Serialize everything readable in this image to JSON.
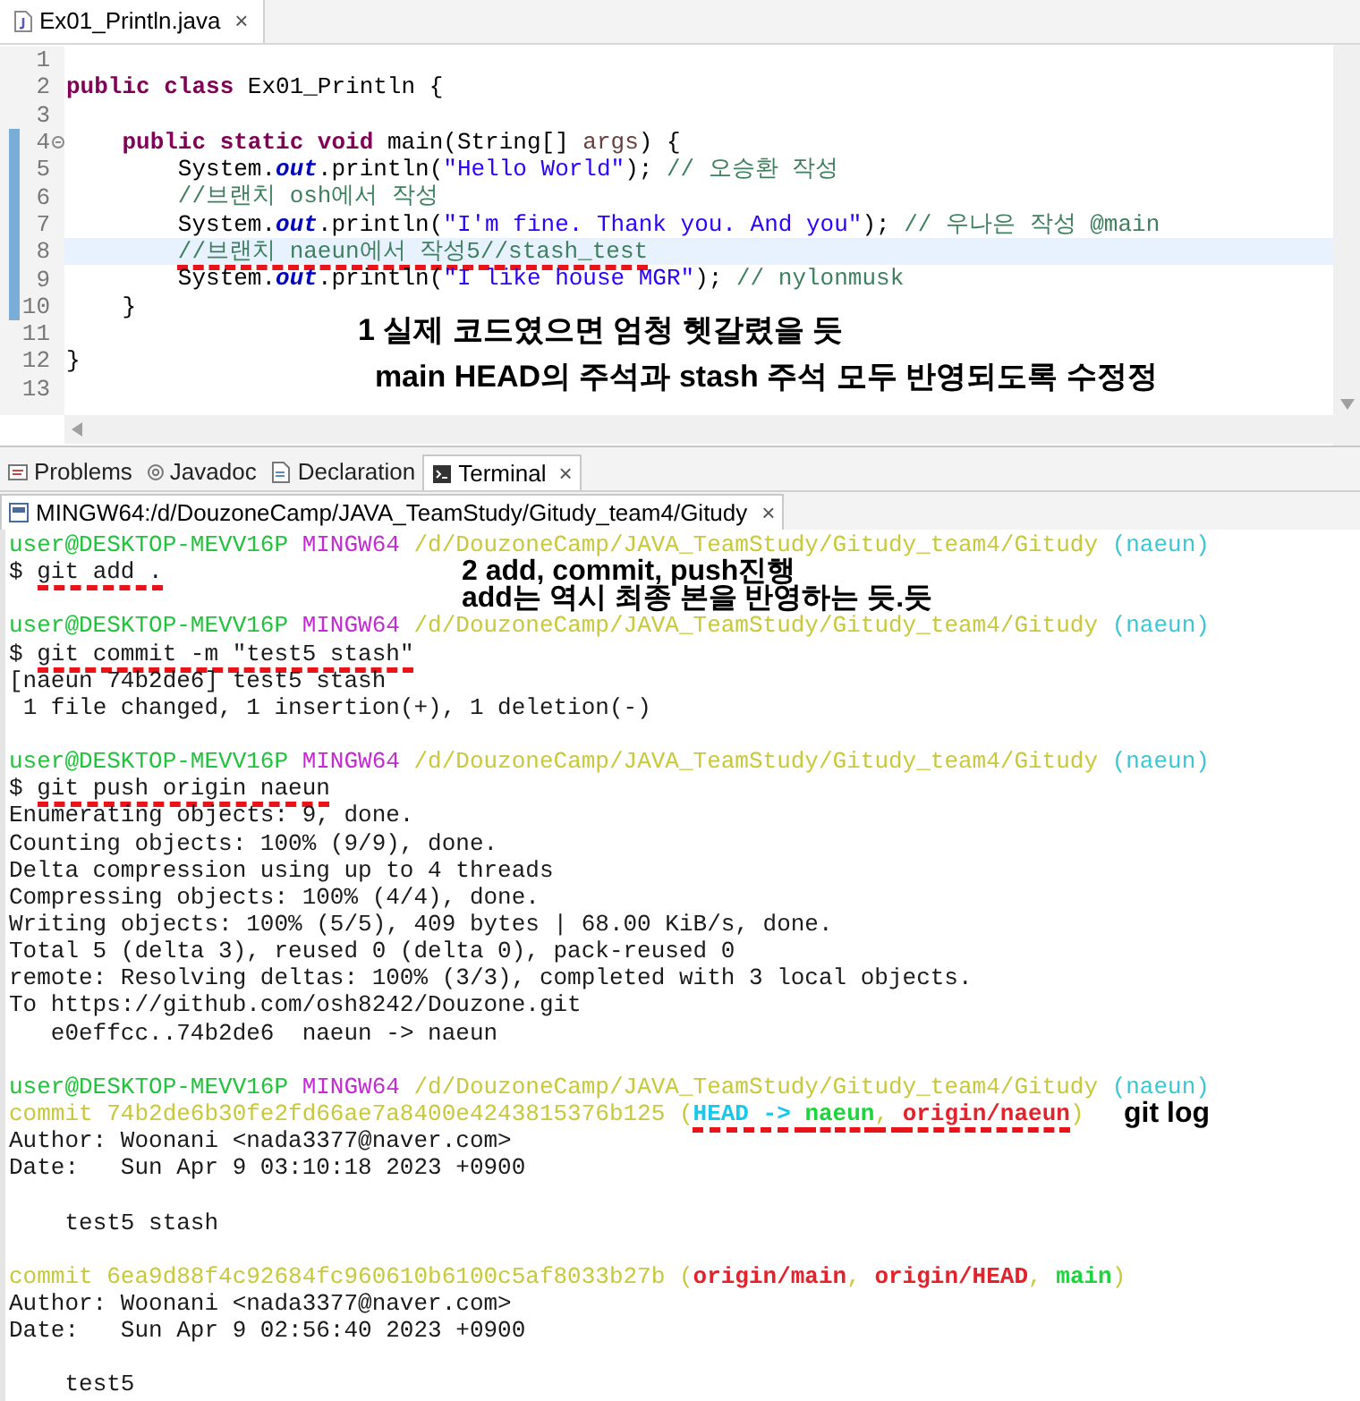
{
  "editor": {
    "tab": {
      "title": "Ex01_Println.java",
      "close": "×"
    },
    "lines": [
      {
        "number": "1",
        "changed": false,
        "current": false,
        "fold": false
      },
      {
        "number": "2",
        "changed": false,
        "current": false,
        "fold": false,
        "segments": [
          {
            "kind": "keyword",
            "text": "public class "
          },
          {
            "kind": "plain",
            "text": "Ex01_Println {"
          }
        ]
      },
      {
        "number": "3",
        "changed": false,
        "current": false,
        "fold": false
      },
      {
        "number": "4",
        "changed": true,
        "current": false,
        "fold": true,
        "segments": [
          {
            "kind": "keyword",
            "text": "    public static void "
          },
          {
            "kind": "plain",
            "text": "main(String[] "
          },
          {
            "kind": "param",
            "text": "args"
          },
          {
            "kind": "plain",
            "text": ") {"
          }
        ]
      },
      {
        "number": "5",
        "changed": true,
        "current": false,
        "fold": false,
        "segments": [
          {
            "kind": "plain",
            "text": "        System."
          },
          {
            "kind": "field",
            "text": "out"
          },
          {
            "kind": "plain",
            "text": ".println("
          },
          {
            "kind": "string",
            "text": "\"Hello World\""
          },
          {
            "kind": "plain",
            "text": "); "
          },
          {
            "kind": "comment",
            "text": "// 오승환 작성"
          }
        ]
      },
      {
        "number": "6",
        "changed": true,
        "current": false,
        "fold": false,
        "segments": [
          {
            "kind": "comment",
            "text": "        //브랜치 osh에서 작성"
          }
        ]
      },
      {
        "number": "7",
        "changed": true,
        "current": false,
        "fold": false,
        "segments": [
          {
            "kind": "plain",
            "text": "        System."
          },
          {
            "kind": "field",
            "text": "out"
          },
          {
            "kind": "plain",
            "text": ".println("
          },
          {
            "kind": "string",
            "text": "\"I'm fine. Thank you. And you\""
          },
          {
            "kind": "plain",
            "text": "); "
          },
          {
            "kind": "comment",
            "text": "// 우나은 작성 @main"
          }
        ]
      },
      {
        "number": "8",
        "changed": true,
        "current": true,
        "fold": false,
        "segments": [
          {
            "kind": "comment",
            "text": "        //브랜치 naeun에서 작성5//stash_test",
            "marked": true
          }
        ]
      },
      {
        "number": "9",
        "changed": true,
        "current": false,
        "fold": false,
        "segments": [
          {
            "kind": "plain",
            "text": "        System."
          },
          {
            "kind": "field",
            "text": "out"
          },
          {
            "kind": "plain",
            "text": ".println("
          },
          {
            "kind": "string",
            "text": "\"I like house MGR\""
          },
          {
            "kind": "plain",
            "text": "); "
          },
          {
            "kind": "comment",
            "text": "// nylonmusk"
          }
        ]
      },
      {
        "number": "10",
        "changed": true,
        "current": false,
        "fold": false,
        "segments": [
          {
            "kind": "plain",
            "text": "    }"
          }
        ]
      },
      {
        "number": "11",
        "changed": false,
        "current": false,
        "fold": false
      },
      {
        "number": "12",
        "changed": false,
        "current": false,
        "fold": false,
        "segments": [
          {
            "kind": "plain",
            "text": "}"
          }
        ]
      },
      {
        "number": "13",
        "changed": false,
        "current": false,
        "fold": false
      }
    ]
  },
  "view_tabs": [
    {
      "label": "Problems",
      "selected": false
    },
    {
      "label": "Javadoc",
      "selected": false
    },
    {
      "label": "Declaration",
      "selected": false
    },
    {
      "label": "Terminal",
      "selected": true,
      "close": "×"
    }
  ],
  "terminal": {
    "tab": {
      "title": "MINGW64:/d/DouzoneCamp/JAVA_TeamStudy/Gitudy_team4/Gitudy",
      "close": "×"
    },
    "lines": [
      {
        "kind": "text",
        "segments": [
          {
            "kind": "user",
            "text": "user@DESKTOP-MEVV16P "
          },
          {
            "kind": "shell",
            "text": "MINGW64 "
          },
          {
            "kind": "path",
            "text": "/d/DouzoneCamp/JAVA_TeamStudy/Gitudy_team4/Gitudy "
          },
          {
            "kind": "branch",
            "text": "(naeun)"
          }
        ]
      },
      {
        "kind": "text",
        "segments": [
          {
            "kind": "plain",
            "text": "$ "
          },
          {
            "kind": "plain",
            "text": "git add .",
            "marked": true
          }
        ]
      },
      {
        "kind": "blank"
      },
      {
        "kind": "text",
        "segments": [
          {
            "kind": "user",
            "text": "user@DESKTOP-MEVV16P "
          },
          {
            "kind": "shell",
            "text": "MINGW64 "
          },
          {
            "kind": "path",
            "text": "/d/DouzoneCamp/JAVA_TeamStudy/Gitudy_team4/Gitudy "
          },
          {
            "kind": "branch",
            "text": "(naeun)"
          }
        ]
      },
      {
        "kind": "text",
        "segments": [
          {
            "kind": "plain",
            "text": "$ "
          },
          {
            "kind": "plain",
            "text": "git commit -m \"test5 stash\"",
            "marked": true
          }
        ]
      },
      {
        "kind": "text",
        "segments": [
          {
            "kind": "plain",
            "text": "[naeun 74b2de6] test5 stash"
          }
        ]
      },
      {
        "kind": "text",
        "segments": [
          {
            "kind": "plain",
            "text": " 1 file changed, 1 insertion(+), 1 deletion(-)"
          }
        ]
      },
      {
        "kind": "blank"
      },
      {
        "kind": "text",
        "segments": [
          {
            "kind": "user",
            "text": "user@DESKTOP-MEVV16P "
          },
          {
            "kind": "shell",
            "text": "MINGW64 "
          },
          {
            "kind": "path",
            "text": "/d/DouzoneCamp/JAVA_TeamStudy/Gitudy_team4/Gitudy "
          },
          {
            "kind": "branch",
            "text": "(naeun)"
          }
        ]
      },
      {
        "kind": "text",
        "segments": [
          {
            "kind": "plain",
            "text": "$ "
          },
          {
            "kind": "plain",
            "text": "git push origin naeun",
            "marked": true
          }
        ]
      },
      {
        "kind": "text",
        "segments": [
          {
            "kind": "plain",
            "text": "Enumerating objects: 9, done."
          }
        ]
      },
      {
        "kind": "text",
        "segments": [
          {
            "kind": "plain",
            "text": "Counting objects: 100% (9/9), done."
          }
        ]
      },
      {
        "kind": "text",
        "segments": [
          {
            "kind": "plain",
            "text": "Delta compression using up to 4 threads"
          }
        ]
      },
      {
        "kind": "text",
        "segments": [
          {
            "kind": "plain",
            "text": "Compressing objects: 100% (4/4), done."
          }
        ]
      },
      {
        "kind": "text",
        "segments": [
          {
            "kind": "plain",
            "text": "Writing objects: 100% (5/5), 409 bytes | 68.00 KiB/s, done."
          }
        ]
      },
      {
        "kind": "text",
        "segments": [
          {
            "kind": "plain",
            "text": "Total 5 (delta 3), reused 0 (delta 0), pack-reused 0"
          }
        ]
      },
      {
        "kind": "text",
        "segments": [
          {
            "kind": "plain",
            "text": "remote: Resolving deltas: 100% (3/3), completed with 3 local objects."
          }
        ]
      },
      {
        "kind": "text",
        "segments": [
          {
            "kind": "plain",
            "text": "To https://github.com/osh8242/Douzone.git"
          }
        ]
      },
      {
        "kind": "text",
        "segments": [
          {
            "kind": "plain",
            "text": "   e0effcc..74b2de6  naeun -> naeun"
          }
        ]
      },
      {
        "kind": "blank"
      },
      {
        "kind": "text",
        "segments": [
          {
            "kind": "user",
            "text": "user@DESKTOP-MEVV16P "
          },
          {
            "kind": "shell",
            "text": "MINGW64 "
          },
          {
            "kind": "path",
            "text": "/d/DouzoneCamp/JAVA_TeamStudy/Gitudy_team4/Gitudy "
          },
          {
            "kind": "branch",
            "text": "(naeun)"
          }
        ]
      },
      {
        "kind": "text",
        "segments": [
          {
            "kind": "path",
            "text": "commit 74b2de6b30fe2fd66ae7a8400e4243815376b125 ("
          },
          {
            "kind": "head",
            "text": "HEAD -> ",
            "marked": true
          },
          {
            "kind": "local",
            "text": "naeun",
            "marked": true
          },
          {
            "kind": "path",
            "text": ", ",
            "marked": true
          },
          {
            "kind": "remote",
            "text": "origin/naeun",
            "marked": true
          },
          {
            "kind": "path",
            "text": ")"
          }
        ]
      },
      {
        "kind": "text",
        "segments": [
          {
            "kind": "plain",
            "text": "Author: Woonani <nada3377@naver.com>"
          }
        ]
      },
      {
        "kind": "text",
        "segments": [
          {
            "kind": "plain",
            "text": "Date:   Sun Apr 9 03:10:18 2023 +0900"
          }
        ]
      },
      {
        "kind": "blank"
      },
      {
        "kind": "text",
        "segments": [
          {
            "kind": "plain",
            "text": "    test5 stash"
          }
        ]
      },
      {
        "kind": "blank"
      },
      {
        "kind": "text",
        "segments": [
          {
            "kind": "path",
            "text": "commit 6ea9d88f4c92684fc960610b6100c5af8033b27b ("
          },
          {
            "kind": "remote",
            "text": "origin/main"
          },
          {
            "kind": "path",
            "text": ", "
          },
          {
            "kind": "remote",
            "text": "origin/HEAD"
          },
          {
            "kind": "path",
            "text": ", "
          },
          {
            "kind": "local",
            "text": "main"
          },
          {
            "kind": "path",
            "text": ")"
          }
        ]
      },
      {
        "kind": "text",
        "segments": [
          {
            "kind": "plain",
            "text": "Author: Woonani <nada3377@naver.com>"
          }
        ]
      },
      {
        "kind": "text",
        "segments": [
          {
            "kind": "plain",
            "text": "Date:   Sun Apr 9 02:56:40 2023 +0900"
          }
        ]
      },
      {
        "kind": "blank"
      },
      {
        "kind": "text",
        "segments": [
          {
            "kind": "plain",
            "text": "    test5"
          }
        ]
      }
    ]
  },
  "notes": [
    {
      "lines": [
        "1 실제 코드였으면 엄청 헷갈렸을 듯",
        "  main HEAD의 주석과 stash 주석 모두 반영되도록 수정정"
      ],
      "kind": "editor"
    },
    {
      "lines": [
        "2 add, commit, push진행",
        "add는 역시 최종 본을 반영하는 듯.듯"
      ],
      "kind": "add"
    },
    {
      "lines": [
        "git log"
      ],
      "kind": "log"
    }
  ]
}
